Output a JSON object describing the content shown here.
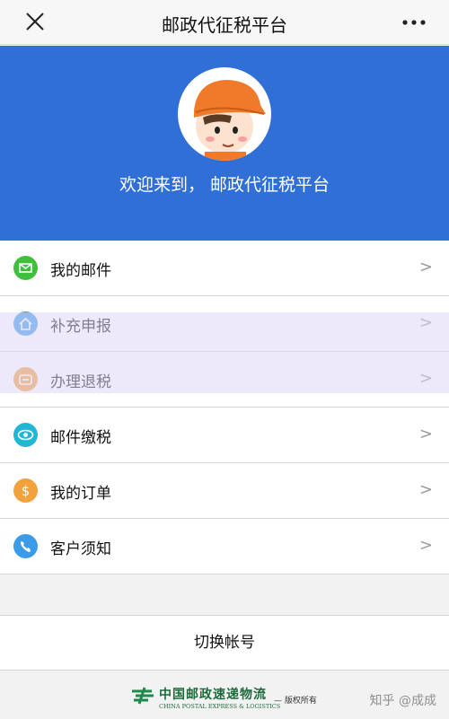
{
  "header": {
    "title": "邮政代征税平台"
  },
  "hero": {
    "welcome": "欢迎来到，  邮政代征税平台"
  },
  "menu": {
    "chevron": ">",
    "items": [
      {
        "label": "我的邮件",
        "icon": "mail-icon",
        "color": "#3fbf3c"
      },
      {
        "label": "补充申报",
        "icon": "house-icon",
        "color": "#3a9be8"
      },
      {
        "label": "办理退税",
        "icon": "refund-icon",
        "color": "#f2a23c"
      },
      {
        "label": "邮件缴税",
        "icon": "tax-eye-icon",
        "color": "#22b6d6"
      },
      {
        "label": "我的订单",
        "icon": "dollar-icon",
        "color": "#f2a23c"
      },
      {
        "label": "客户须知",
        "icon": "phone-icon",
        "color": "#3a9be8"
      }
    ]
  },
  "switch_account": {
    "label": "切换帐号"
  },
  "footer": {
    "org_cn": "中国邮政速递物流",
    "org_en": "CHINA POSTAL EXPRESS & LOGISTICS",
    "rights": "— 版权所有",
    "watermark": "知乎 @成成"
  }
}
